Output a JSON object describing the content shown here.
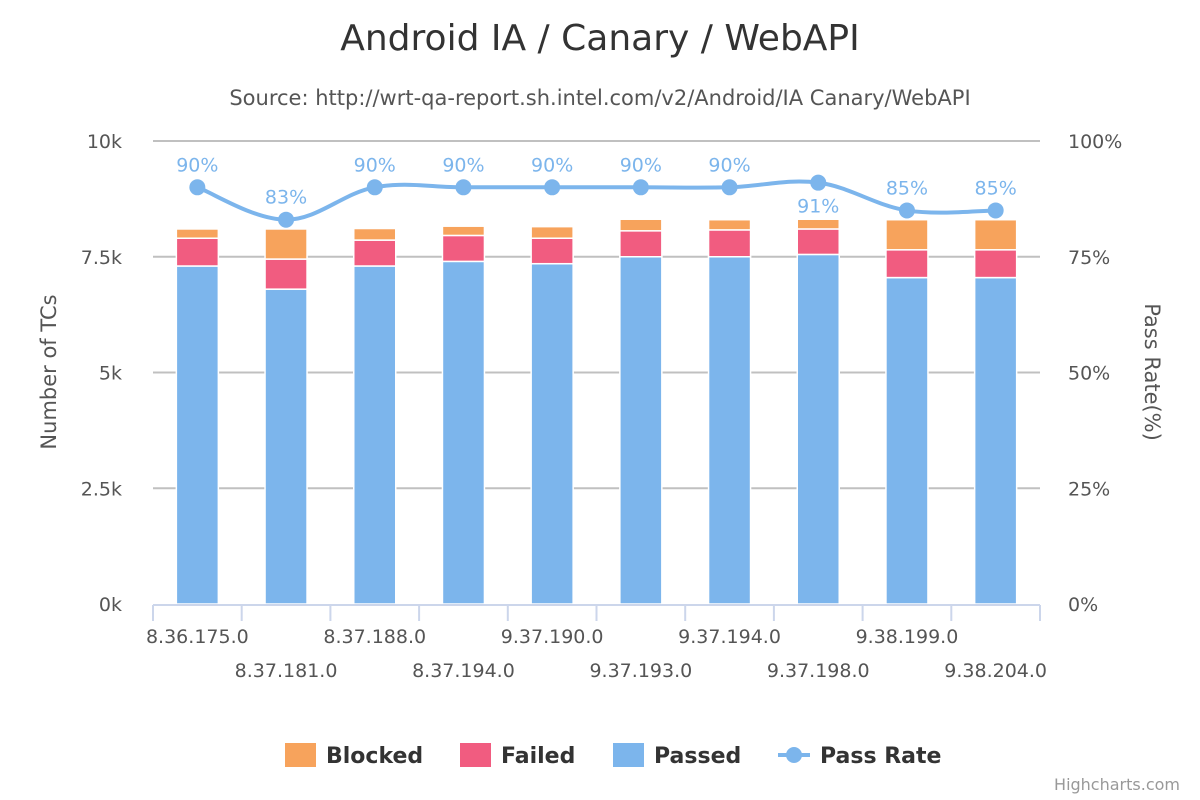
{
  "chart_data": {
    "type": "bar",
    "stacked": true,
    "title": "Android IA / Canary / WebAPI",
    "subtitle": "Source: http://wrt-qa-report.sh.intel.com/v2/Android/IA Canary/WebAPI",
    "xlabel": "",
    "ylabel": "Number of TCs",
    "y2label": "Pass Rate(%)",
    "ylim": [
      0,
      10000
    ],
    "y2lim": [
      0,
      100
    ],
    "yticks": [
      "0k",
      "2.5k",
      "5k",
      "7.5k",
      "10k"
    ],
    "y2ticks": [
      "0%",
      "25%",
      "50%",
      "75%",
      "100%"
    ],
    "grid": true,
    "legend_position": "bottom-center",
    "categories": [
      "8.36.175.0",
      "8.37.181.0",
      "8.37.188.0",
      "8.37.194.0",
      "9.37.190.0",
      "9.37.193.0",
      "9.37.194.0",
      "9.37.198.0",
      "9.38.199.0",
      "9.38.204.0"
    ],
    "series": [
      {
        "name": "Blocked",
        "type": "bar",
        "color": "#f7a35c",
        "values": [
          200,
          650,
          250,
          200,
          250,
          250,
          220,
          210,
          650,
          650
        ]
      },
      {
        "name": "Failed",
        "type": "bar",
        "color": "#f15c80",
        "values": [
          600,
          650,
          560,
          560,
          550,
          560,
          580,
          550,
          600,
          600
        ]
      },
      {
        "name": "Passed",
        "type": "bar",
        "color": "#7cb5ec",
        "values": [
          7300,
          6800,
          7300,
          7400,
          7350,
          7500,
          7500,
          7550,
          7050,
          7050
        ]
      },
      {
        "name": "Pass Rate",
        "type": "line",
        "axis": "right",
        "color": "#7cb5ec",
        "values": [
          90,
          83,
          90,
          90,
          90,
          90,
          90,
          91,
          85,
          85
        ],
        "labels": [
          "90%",
          "83%",
          "90%",
          "90%",
          "90%",
          "90%",
          "90%",
          "91%",
          "85%",
          "85%"
        ]
      }
    ],
    "credits": "Highcharts.com"
  }
}
